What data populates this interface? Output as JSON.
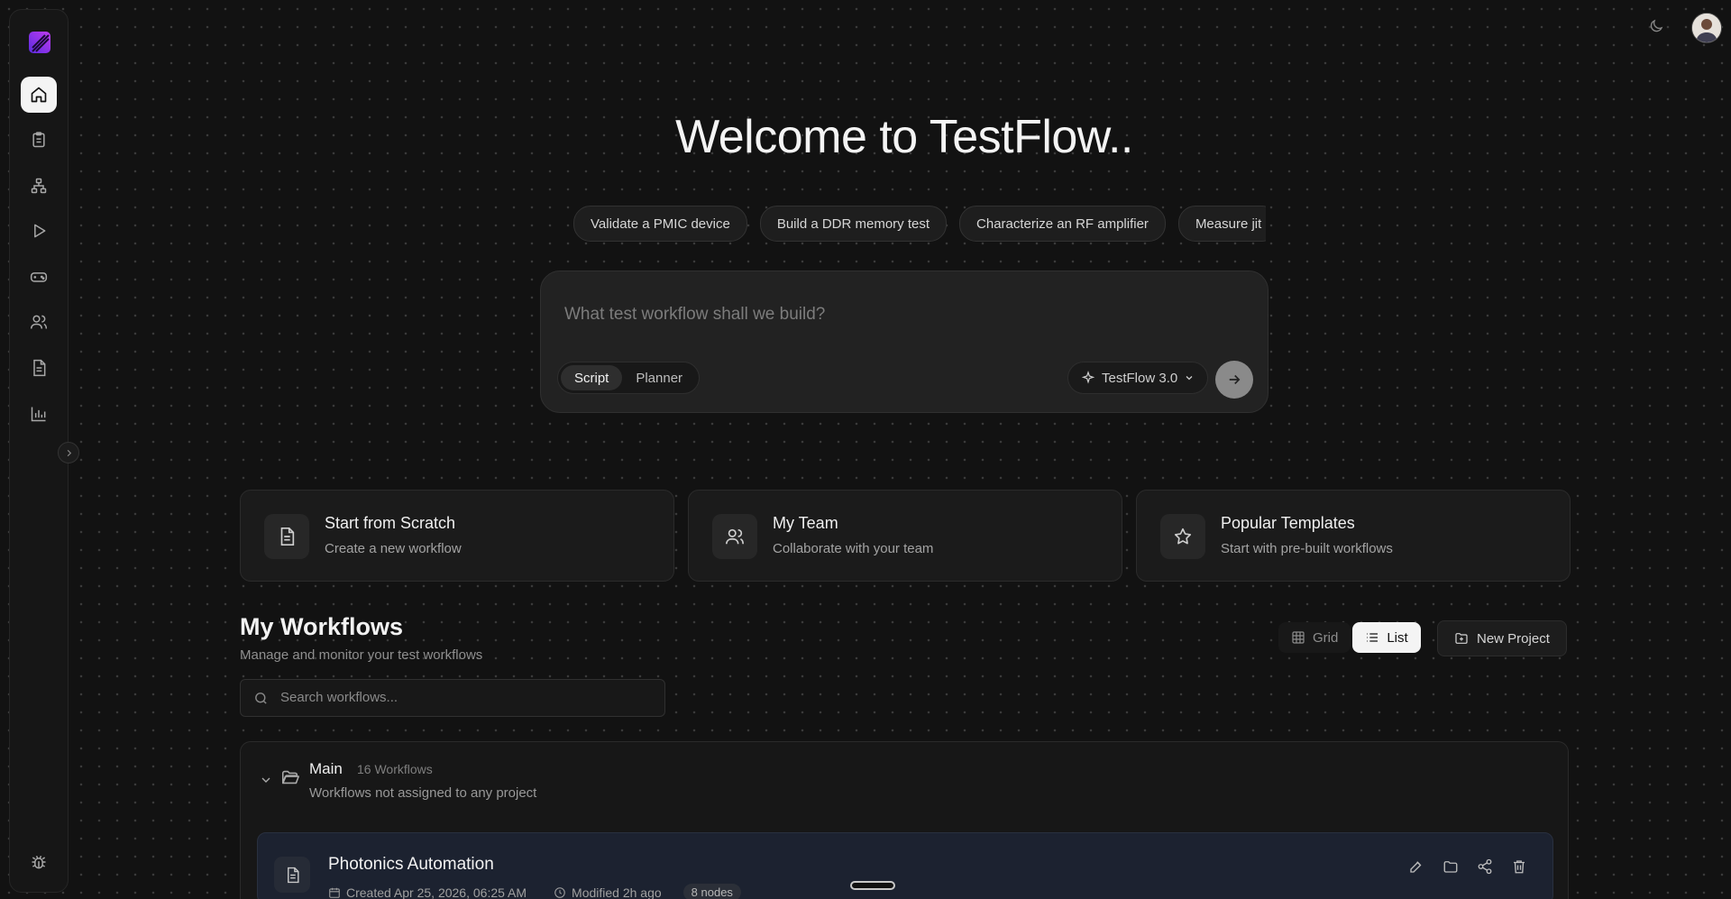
{
  "hero": {
    "title": "Welcome to TestFlow..",
    "suggestions": [
      "Validate a PMIC device",
      "Build a DDR memory test",
      "Characterize an RF amplifier",
      "Measure jit"
    ]
  },
  "prompt": {
    "placeholder": "What test workflow shall we build?",
    "modes": [
      "Script",
      "Planner"
    ],
    "active_mode": "Script",
    "model": "TestFlow 3.0"
  },
  "cards": [
    {
      "title": "Start from Scratch",
      "subtitle": "Create a new workflow",
      "icon": "document-icon"
    },
    {
      "title": "My Team",
      "subtitle": "Collaborate with your team",
      "icon": "users-icon"
    },
    {
      "title": "Popular Templates",
      "subtitle": "Start with pre-built workflows",
      "icon": "star-icon"
    }
  ],
  "workflows": {
    "title": "My Workflows",
    "subtitle": "Manage and monitor your test workflows",
    "search_placeholder": "Search workflows...",
    "view_options": [
      "Grid",
      "List"
    ],
    "active_view": "List",
    "new_project_label": "New Project",
    "group": {
      "name": "Main",
      "count": "16 Workflows",
      "description": "Workflows not assigned to any project"
    },
    "items": [
      {
        "title": "Photonics Automation",
        "created": "Created Apr 25, 2026, 06:25 AM",
        "modified": "Modified 2h ago",
        "nodes": "8 nodes"
      }
    ]
  },
  "sidebar": {
    "items": [
      "home-icon",
      "clipboard-icon",
      "network-icon",
      "play-icon",
      "gamepad-icon",
      "users-icon",
      "file-text-icon",
      "bar-chart-icon"
    ],
    "footer": "bug-icon"
  },
  "colors": {
    "background": "#121212",
    "logo": "#8b3cf7",
    "active_nav": "#f4f4f4"
  }
}
